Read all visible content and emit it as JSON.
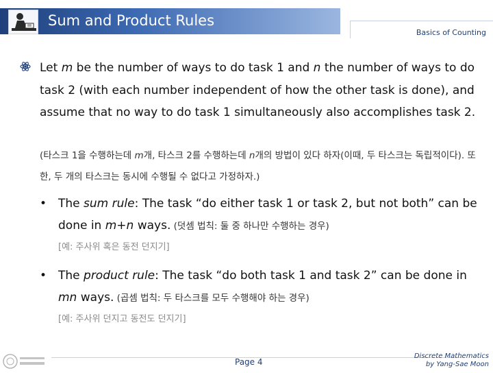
{
  "header": {
    "title": "Sum and Product Rules",
    "subtitle": "Basics of Counting"
  },
  "intro": {
    "p1": "Let ",
    "m": "m",
    "p2": " be the number of ways to do task 1 and ",
    "n": "n",
    "p3": " the number of ways to do task 2 (with each number independent of how the other task is done), and assume that no way to do task 1 simultaneously also accomplishes task 2.",
    "korean_a": "(타스크 1을 수행하는데 ",
    "korean_m": "m",
    "korean_b": "개, 타스크 2를 수행하는데 ",
    "korean_n": "n",
    "korean_c": "개의 방법이 있다 하자(이때, 두 타스크는 독립적이다). 또한, 두 개의 타스크는 동시에 수행될 수 없다고 가정하자.)"
  },
  "sum_rule": {
    "bullet": "•",
    "p1": "The ",
    "term": "sum rule",
    "p2": ": The task “do either task 1 or task 2, but not both” can be done in ",
    "expr": "m+n",
    "p3": " ways.",
    "korean": " (덧셈 법칙: 둘 중 하나만 수행하는 경우)",
    "example": "[예: 주사위 혹은 동전 던지기]"
  },
  "product_rule": {
    "bullet": "•",
    "p1": "The ",
    "term": "product rule",
    "p2": ": The task “do both task 1 and task 2” can be done in ",
    "expr": "mn",
    "p3": " ways.",
    "korean": " (곱셈 법칙: 두 타스크를 모두 수행해야 하는 경우)",
    "example": "[예: 주사위 던지고 동전도 던지기]"
  },
  "footer": {
    "page": "Page 4",
    "course": "Discrete Mathematics",
    "author": "by Yang-Sae Moon"
  },
  "icons": [
    "author-desk-icon",
    "atom-bullet-icon",
    "university-logo-icon"
  ],
  "colors": {
    "header_start": "#1e3f7a",
    "header_end": "#9bb6e0",
    "accent_text": "#1e3f7a"
  }
}
